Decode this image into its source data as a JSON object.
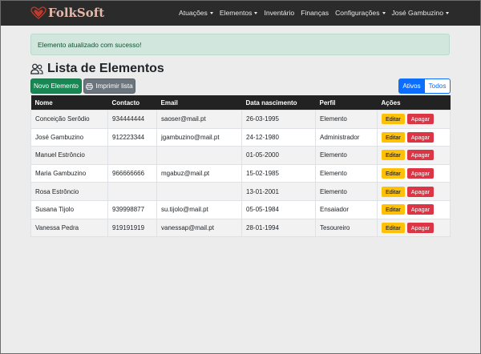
{
  "navbar": {
    "brand": "FolkSoft",
    "items": [
      {
        "label": "Atuações",
        "dropdown": true
      },
      {
        "label": "Elementos",
        "dropdown": true
      },
      {
        "label": "Inventário",
        "dropdown": false
      },
      {
        "label": "Finanças",
        "dropdown": false
      },
      {
        "label": "Configurações",
        "dropdown": true
      },
      {
        "label": "José Gambuzino",
        "dropdown": true
      }
    ]
  },
  "alert": {
    "message": "Elemento atualizado com sucesso!"
  },
  "page": {
    "title": "Lista de Elementos",
    "title_icon": "users-icon"
  },
  "toolbar": {
    "new_label": "Novo Elemento",
    "print_label": "Imprimir lista",
    "filter_active": "Ativos",
    "filter_all": "Todos"
  },
  "table": {
    "columns": [
      "Nome",
      "Contacto",
      "Email",
      "Data nascimento",
      "Perfil",
      "Ações"
    ],
    "rows": [
      {
        "nome": "Conceição Serôdio",
        "contacto": "934444444",
        "email": "saoser@mail.pt",
        "nascimento": "26-03-1995",
        "perfil": "Elemento"
      },
      {
        "nome": "José Gambuzino",
        "contacto": "912223344",
        "email": "jgambuzino@mail.pt",
        "nascimento": "24-12-1980",
        "perfil": "Administrador"
      },
      {
        "nome": "Manuel Estrôncio",
        "contacto": "",
        "email": "",
        "nascimento": "01-05-2000",
        "perfil": "Elemento"
      },
      {
        "nome": "Maria Gambuzino",
        "contacto": "966666666",
        "email": "mgabuz@mail.pt",
        "nascimento": "15-02-1985",
        "perfil": "Elemento"
      },
      {
        "nome": "Rosa Estrôncio",
        "contacto": "",
        "email": "",
        "nascimento": "13-01-2001",
        "perfil": "Elemento"
      },
      {
        "nome": "Susana Tijolo",
        "contacto": "939998877",
        "email": "su.tijolo@mail.pt",
        "nascimento": "05-05-1984",
        "perfil": "Ensaiador"
      },
      {
        "nome": "Vanessa Pedra",
        "contacto": "919191919",
        "email": "vanessap@mail.pt",
        "nascimento": "28-01-1994",
        "perfil": "Tesoureiro"
      }
    ],
    "edit_label": "Editar",
    "delete_label": "Apagar"
  },
  "colors": {
    "navbar": "#2b2b2b",
    "brand": "#e4b9a9",
    "success": "#198754",
    "secondary": "#6c757d",
    "primary": "#0d6efd",
    "warning": "#ffc107",
    "danger": "#dc3545"
  }
}
